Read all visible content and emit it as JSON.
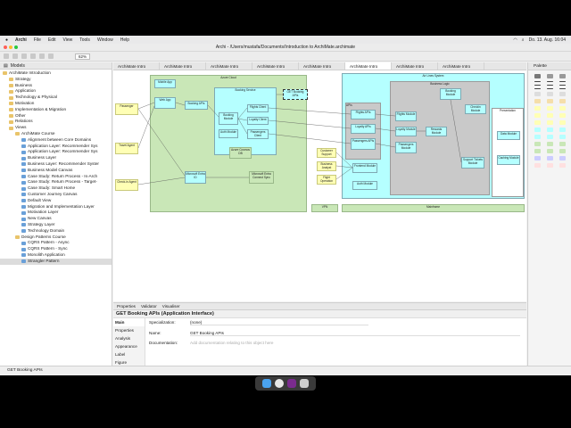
{
  "menubar": {
    "app": "Archi",
    "items": [
      "File",
      "Edit",
      "View",
      "Tools",
      "Window",
      "Help"
    ],
    "clock": "Do. 13. Aug.  16:04"
  },
  "window": {
    "title": "Archi - /Users/mustafa/Documents/Introduction to ArchiMate.archimate",
    "zoom": "62%"
  },
  "models": {
    "header": "Models",
    "items": [
      {
        "label": "ArchiMate Introduction",
        "depth": 0,
        "kind": "model"
      },
      {
        "label": "Strategy",
        "depth": 1,
        "kind": "folder"
      },
      {
        "label": "Business",
        "depth": 1,
        "kind": "folder"
      },
      {
        "label": "Application",
        "depth": 1,
        "kind": "folder"
      },
      {
        "label": "Technology & Physical",
        "depth": 1,
        "kind": "folder"
      },
      {
        "label": "Motivation",
        "depth": 1,
        "kind": "folder"
      },
      {
        "label": "Implementation & Migration",
        "depth": 1,
        "kind": "folder"
      },
      {
        "label": "Other",
        "depth": 1,
        "kind": "folder"
      },
      {
        "label": "Relations",
        "depth": 1,
        "kind": "folder"
      },
      {
        "label": "Views",
        "depth": 1,
        "kind": "folder"
      },
      {
        "label": "ArchiMate Course",
        "depth": 2,
        "kind": "folder"
      },
      {
        "label": "Alignment between Core Domains",
        "depth": 3,
        "kind": "view"
      },
      {
        "label": "Application Layer: Recommender Sys",
        "depth": 3,
        "kind": "view"
      },
      {
        "label": "Application Layer: Recommender Sys",
        "depth": 3,
        "kind": "view"
      },
      {
        "label": "Business Layer",
        "depth": 3,
        "kind": "view"
      },
      {
        "label": "Business Layer: Recommender Syster",
        "depth": 3,
        "kind": "view"
      },
      {
        "label": "Business Model Canvas",
        "depth": 3,
        "kind": "view"
      },
      {
        "label": "Case Study: Return Process - Is-Arch",
        "depth": 3,
        "kind": "view"
      },
      {
        "label": "Case Study: Return Process - Target-",
        "depth": 3,
        "kind": "view"
      },
      {
        "label": "Case Study: Smart Home",
        "depth": 3,
        "kind": "view"
      },
      {
        "label": "Customer Journey Canvas",
        "depth": 3,
        "kind": "view"
      },
      {
        "label": "Default View",
        "depth": 3,
        "kind": "view"
      },
      {
        "label": "Migration and Implementation Layer",
        "depth": 3,
        "kind": "view"
      },
      {
        "label": "Motivation Layer",
        "depth": 3,
        "kind": "view"
      },
      {
        "label": "New Canvas",
        "depth": 3,
        "kind": "view"
      },
      {
        "label": "Strategy Layer",
        "depth": 3,
        "kind": "view"
      },
      {
        "label": "Technology Domain",
        "depth": 3,
        "kind": "view"
      },
      {
        "label": "Design Patterns Course",
        "depth": 2,
        "kind": "folder"
      },
      {
        "label": "CQRS Pattern - Async",
        "depth": 3,
        "kind": "view"
      },
      {
        "label": "CQRS Pattern - Sync",
        "depth": 3,
        "kind": "view"
      },
      {
        "label": "Monolith Application",
        "depth": 3,
        "kind": "view"
      },
      {
        "label": "Strangler Pattern",
        "depth": 3,
        "kind": "view",
        "selected": true
      }
    ]
  },
  "tabs": [
    "ArchiMate Intro",
    "ArchiMate Intro",
    "ArchiMate Intro",
    "ArchiMate Intro",
    "ArchiMate Intro",
    "ArchiMate Intro",
    "ArchiMate Intro",
    "ArchiMate Intro"
  ],
  "diagram": {
    "azure_cloud": "Azure Cloud",
    "booking_service": "Booking Service",
    "get_booking_apis": "GET Booking APIs",
    "booking_module": "Booking Module",
    "flights_client": "Flights Client",
    "loyalty_client": "Loyalty Client",
    "passengers_client": "Passengers Client",
    "auth_module": "Auth Module",
    "azure_cosmos": "Azure Cosmos DB",
    "web_app": "Web App",
    "mobile_app": "Mobile App",
    "booking_apis": "Booking APIs",
    "entra_id": "Microsoft Entra ID",
    "entra_connect": "Microsoft Entra Connect Sync",
    "passenger": "Passenger",
    "travel_agent": "Travel Agent",
    "checkin_agent": "Check-in Agent",
    "airlines_system": "Air Lines System",
    "business_logic": "Business Logic",
    "apis": "APIs",
    "presentation": "Presentation",
    "flights_apis": "Flights APIs",
    "loyalty_apis": "Loyalty APIs",
    "passengers_apis": "Passengers APIs",
    "flights_module": "Flights Module",
    "loyalty_module": "Loyalty Module",
    "passengers_module": "Passengers Module",
    "rewards_module": "Rewards Module",
    "booking_module2": "Booking Module",
    "checkin_module": "Checkin Module",
    "support_module": "Support Tickets Module",
    "data_module": "Data Module",
    "caching_module": "Caching Module",
    "customer_support": "Customer Support",
    "business_analyst": "Business Analyst",
    "flight_operation": "Flight Operation",
    "frontend_module": "Frontend Module",
    "auth_module2": "Auth Module",
    "vpn": "VPN",
    "mainframe": "Mainframe"
  },
  "palette": {
    "header": "Palette"
  },
  "properties": {
    "tabs": [
      "Properties",
      "Validator",
      "Visualiser"
    ],
    "title": "GET Booking APIs (Application Interface)",
    "sections": [
      "Main",
      "Properties",
      "Analysis",
      "Appearance",
      "Label",
      "Figure",
      "Image"
    ],
    "specialization_label": "Specialization:",
    "specialization_value": "(none)",
    "name_label": "Name:",
    "name_value": "GET Booking APIs",
    "documentation_label": "Documentation:",
    "documentation_placeholder": "Add documentation relating to this object here"
  },
  "status": "GET Booking APIs",
  "colors": {
    "application": "#b5ffff",
    "business": "#ffffb5",
    "technology": "#c9e7b7"
  }
}
